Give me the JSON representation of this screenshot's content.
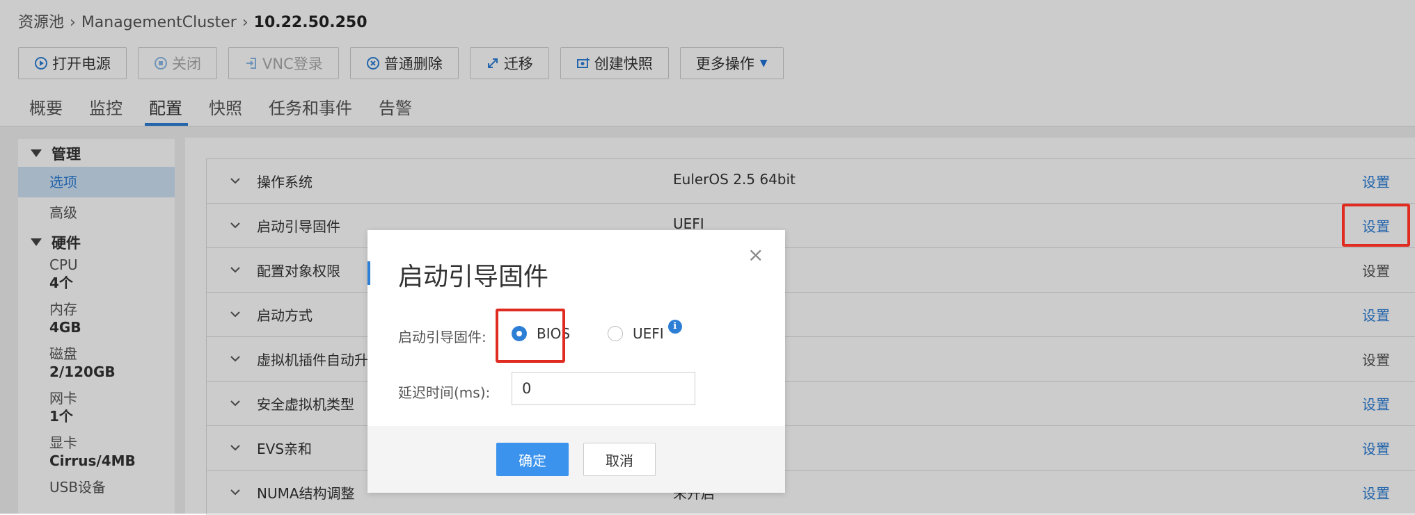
{
  "breadcrumb": {
    "root": "资源池",
    "cluster": "ManagementCluster",
    "current": "10.22.50.250"
  },
  "toolbar": {
    "power_on": "打开电源",
    "power_off": "关闭",
    "vnc": "VNC登录",
    "delete": "普通删除",
    "migrate": "迁移",
    "snapshot": "创建快照",
    "more": "更多操作"
  },
  "tabs": [
    "概要",
    "监控",
    "配置",
    "快照",
    "任务和事件",
    "告警"
  ],
  "active_tab": "配置",
  "sidebar": {
    "manage_group": "管理",
    "manage_items": [
      "选项",
      "高级"
    ],
    "hardware_group": "硬件",
    "hardware": [
      {
        "label": "CPU",
        "value": "4个"
      },
      {
        "label": "内存",
        "value": "4GB"
      },
      {
        "label": "磁盘",
        "value": "2/120GB"
      },
      {
        "label": "网卡",
        "value": "1个"
      },
      {
        "label": "显卡",
        "value": "Cirrus/4MB"
      },
      {
        "label": "USB设备",
        "value": ""
      }
    ]
  },
  "properties": [
    {
      "name": "操作系统",
      "value": "EulerOS 2.5 64bit",
      "action": "设置"
    },
    {
      "name": "启动引导固件",
      "value": "UEFI",
      "action": "设置"
    },
    {
      "name": "配置对象权限",
      "value": "",
      "action": "设置"
    },
    {
      "name": "启动方式",
      "value": "",
      "action": "设置"
    },
    {
      "name": "虚拟机插件自动升级",
      "value": "",
      "action": "设置"
    },
    {
      "name": "安全虚拟机类型",
      "value": "",
      "action": "设置"
    },
    {
      "name": "EVS亲和",
      "value": "",
      "action": "设置"
    },
    {
      "name": "NUMA结构调整",
      "value": "未开启",
      "action": "设置"
    }
  ],
  "modal": {
    "title": "启动引导固件",
    "close": "×",
    "firmware_label": "启动引导固件:",
    "option_bios": "BIOS",
    "option_uefi": "UEFI",
    "selected": "BIOS",
    "info_icon": "i",
    "delay_label": "延迟时间(ms):",
    "delay_value": "0",
    "ok": "确定",
    "cancel": "取消"
  },
  "colors": {
    "accent": "#2d7fd6",
    "highlight": "#e02b20",
    "primary_button": "#3b93ee"
  }
}
